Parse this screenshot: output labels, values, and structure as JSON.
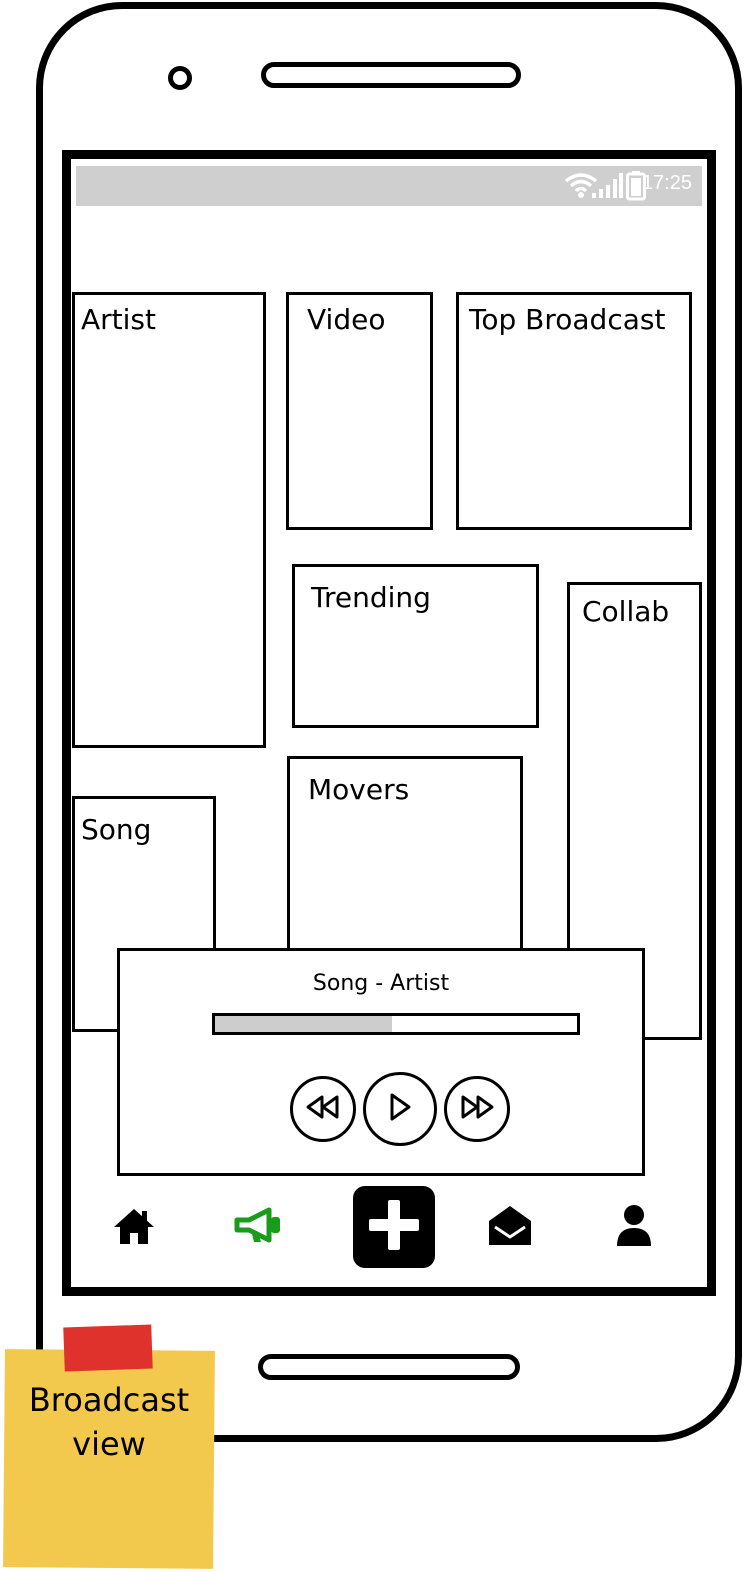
{
  "status_bar": {
    "time": "17:25",
    "icons": [
      "wifi-icon",
      "signal-icon",
      "battery-icon"
    ]
  },
  "cards": {
    "artist": "Artist",
    "video": "Video",
    "top_broadcast": "Top Broadcast",
    "trending": "Trending",
    "collab": "Collab",
    "song": "Song",
    "movers": "Movers"
  },
  "player": {
    "now_playing": "Song - Artist",
    "progress": 0.49,
    "controls": [
      "rewind-icon",
      "play-icon",
      "fast-forward-icon"
    ]
  },
  "bottom_nav": {
    "items": [
      "home-icon",
      "megaphone-icon",
      "plus-icon",
      "envelope-icon",
      "user-icon"
    ],
    "active": "megaphone-icon",
    "active_color": "#1a9b1a"
  },
  "sticky_note": {
    "text": "Broadcast\nview",
    "color": "#f2c94c",
    "tape_color": "#e0322d"
  }
}
